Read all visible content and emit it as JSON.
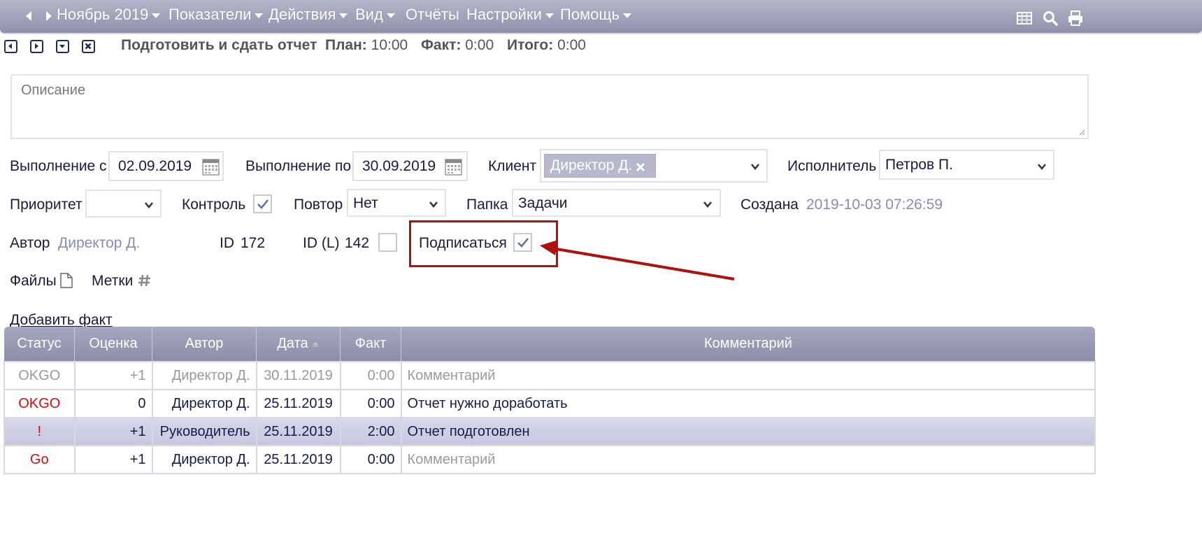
{
  "menubar": {
    "month": "Ноябрь 2019",
    "items": [
      {
        "label": "Показатели",
        "dropdown": true
      },
      {
        "label": "Действия",
        "dropdown": true
      },
      {
        "label": "Вид",
        "dropdown": true
      },
      {
        "label": "Отчёты",
        "dropdown": false
      },
      {
        "label": "Настройки",
        "dropdown": true
      },
      {
        "label": "Помощь",
        "dropdown": true
      }
    ],
    "icons": [
      "table-icon",
      "search-icon",
      "print-icon"
    ]
  },
  "task": {
    "title": "Подготовить и сдать отчет",
    "plan_label": "План:",
    "plan_value": "10:00",
    "fact_label": "Факт:",
    "fact_value": "0:00",
    "total_label": "Итого:",
    "total_value": "0:00"
  },
  "form": {
    "description_placeholder": "Описание",
    "start_label": "Выполнение с",
    "start_value": "02.09.2019",
    "end_label": "Выполнение по",
    "end_value": "30.09.2019",
    "client_label": "Клиент",
    "client_tag": "Директор Д.",
    "executor_label": "Исполнитель",
    "executor_value": "Петров П.",
    "priority_label": "Приоритет",
    "priority_value": "",
    "control_label": "Контроль",
    "control_checked": true,
    "repeat_label": "Повтор",
    "repeat_value": "Нет",
    "folder_label": "Папка",
    "folder_value": "Задачи",
    "created_label": "Создана",
    "created_value": "2019-10-03 07:26:59",
    "author_label": "Автор",
    "author_value": "Директор Д.",
    "id_label": "ID",
    "id_value": "172",
    "idl_label": "ID (L)",
    "idl_value": "142",
    "idl_checked": false,
    "subscribe_label": "Подписаться",
    "subscribe_checked": true,
    "files_label": "Файлы",
    "tags_label": "Метки",
    "add_fact_link": "Добавить факт"
  },
  "annotation": {
    "highlight_color": "#b01010"
  },
  "table": {
    "columns": [
      "Статус",
      "Оценка",
      "Автор",
      "Дата",
      "Факт",
      "Комментарий"
    ],
    "rows": [
      {
        "status": "OKGO",
        "score": "+1",
        "author": "Директор Д.",
        "date": "30.11.2019",
        "fact": "0:00",
        "comment": "Комментарий",
        "style": "dim",
        "status_color": "#999999",
        "comment_placeholder": true
      },
      {
        "status": "OKGO",
        "score": "0",
        "author": "Директор Д.",
        "date": "25.11.2019",
        "fact": "0:00",
        "comment": "Отчет нужно доработать",
        "style": "normal",
        "status_color": "#d01010",
        "comment_placeholder": false
      },
      {
        "status": "!",
        "score": "+1",
        "author": "Руководитель",
        "date": "25.11.2019",
        "fact": "2:00",
        "comment": "Отчет подготовлен",
        "style": "sel",
        "status_color": "#d01010",
        "comment_placeholder": false
      },
      {
        "status": "Go",
        "score": "+1",
        "author": "Директор Д.",
        "date": "25.11.2019",
        "fact": "0:00",
        "comment": "Комментарий",
        "style": "normal",
        "status_color": "#d01010",
        "comment_placeholder": true
      }
    ]
  }
}
